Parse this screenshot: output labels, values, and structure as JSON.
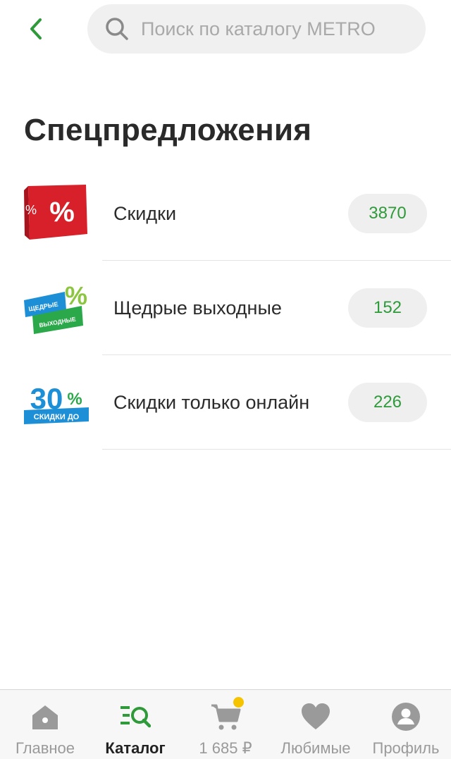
{
  "header": {
    "search_placeholder": "Поиск по каталогу METRO"
  },
  "page": {
    "title": "Спецпредложения"
  },
  "offers": [
    {
      "label": "Скидки",
      "count": "3870",
      "icon": "percent-cube-icon"
    },
    {
      "label": "Щедрые выходные",
      "count": "152",
      "icon": "generous-weekend-badge-icon",
      "badge_text_1": "ЩЕДРЫЕ",
      "badge_text_2": "ВЫХОДНЫЕ"
    },
    {
      "label": "Скидки только онлайн",
      "count": "226",
      "icon": "online-discount-badge-icon",
      "badge_big": "30",
      "badge_pct": "%",
      "badge_text": "СКИДКИ ДО"
    }
  ],
  "bottom_nav": {
    "items": [
      {
        "label": "Главное",
        "icon": "home-icon"
      },
      {
        "label": "Каталог",
        "icon": "catalog-search-icon",
        "active": true
      },
      {
        "label": "1 685 ₽",
        "icon": "cart-icon"
      },
      {
        "label": "Любимые",
        "icon": "heart-icon"
      },
      {
        "label": "Профиль",
        "icon": "profile-icon"
      }
    ]
  },
  "colors": {
    "accent_green": "#2e9a3a",
    "cart_dot": "#f6c300",
    "discount_red": "#d8202a",
    "badge_blue": "#1d8fd6"
  }
}
